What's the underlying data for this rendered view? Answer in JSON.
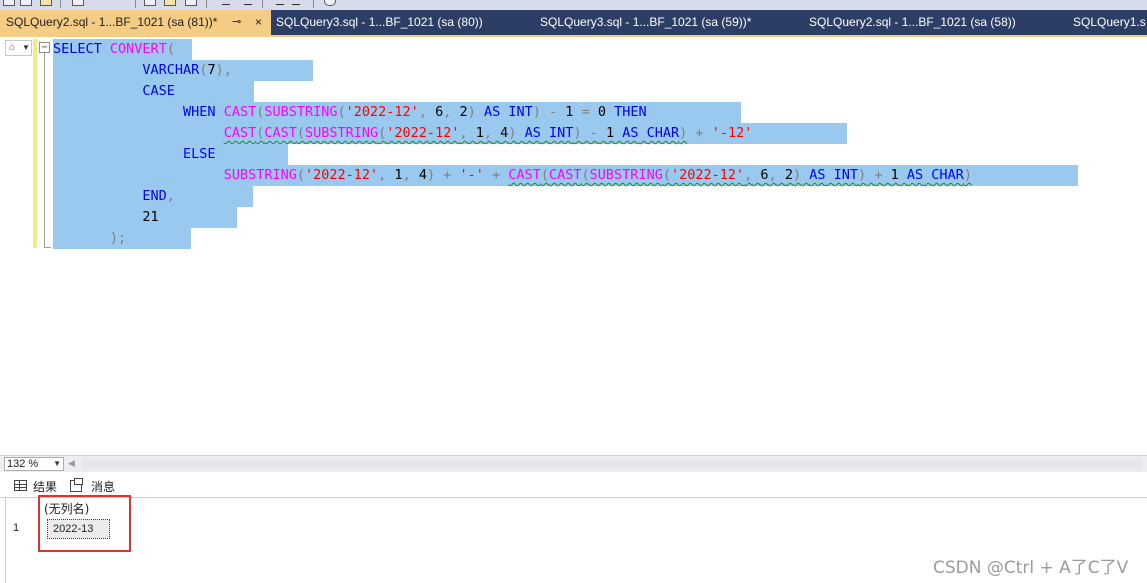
{
  "tabs": [
    {
      "label": "SQLQuery2.sql - 1...BF_1021 (sa (81))*",
      "active": true
    },
    {
      "label": "SQLQuery3.sql - 1...BF_1021 (sa (80))",
      "active": false
    },
    {
      "label": "SQLQuery3.sql - 1...BF_1021 (sa (59))*",
      "active": false
    },
    {
      "label": "SQLQuery2.sql - 1...BF_1021 (sa (58))",
      "active": false
    },
    {
      "label": "SQLQuery1.s",
      "active": false
    }
  ],
  "tab_controls": {
    "pin_icon": "pin-icon",
    "close_label": "×"
  },
  "editor": {
    "collapse_glyph": "−",
    "code_lines": [
      [
        "SELECT CONVERT("
      ],
      [
        "VARCHAR(7),"
      ],
      [
        "CASE"
      ],
      [
        "WHEN CAST(SUBSTRING('2022-12', 6, 2) AS INT) - 1 = 0 THEN"
      ],
      [
        "CAST(CAST(SUBSTRING('2022-12', 1, 4) AS INT) - 1 AS CHAR) + '-12'"
      ],
      [
        "ELSE"
      ],
      [
        "SUBSTRING('2022-12', 1, 4) + '-' + CAST(CAST(SUBSTRING('2022-12', 6, 2) AS INT) + 1 AS CHAR)"
      ],
      [
        "END,"
      ],
      [
        "21"
      ],
      [
        ");"
      ]
    ]
  },
  "zoom": {
    "value": "132 %"
  },
  "results": {
    "tabs": [
      {
        "label": "结果",
        "icon": "grid-icon"
      },
      {
        "label": "消息",
        "icon": "message-icon"
      }
    ],
    "column_header": "(无列名)",
    "rows": [
      {
        "num": "1",
        "value": "2022-13"
      }
    ]
  },
  "watermark": "CSDN @Ctrl + A了C了V",
  "colors": {
    "tab_strip": "#2d3e66",
    "active_tab": "#f5cc84",
    "selection": "#99c9ef",
    "keyword": "#0000ff",
    "function": "#ff00ff",
    "string": "#ff0000",
    "operator": "#808080",
    "highlight_box": "#e03030"
  }
}
